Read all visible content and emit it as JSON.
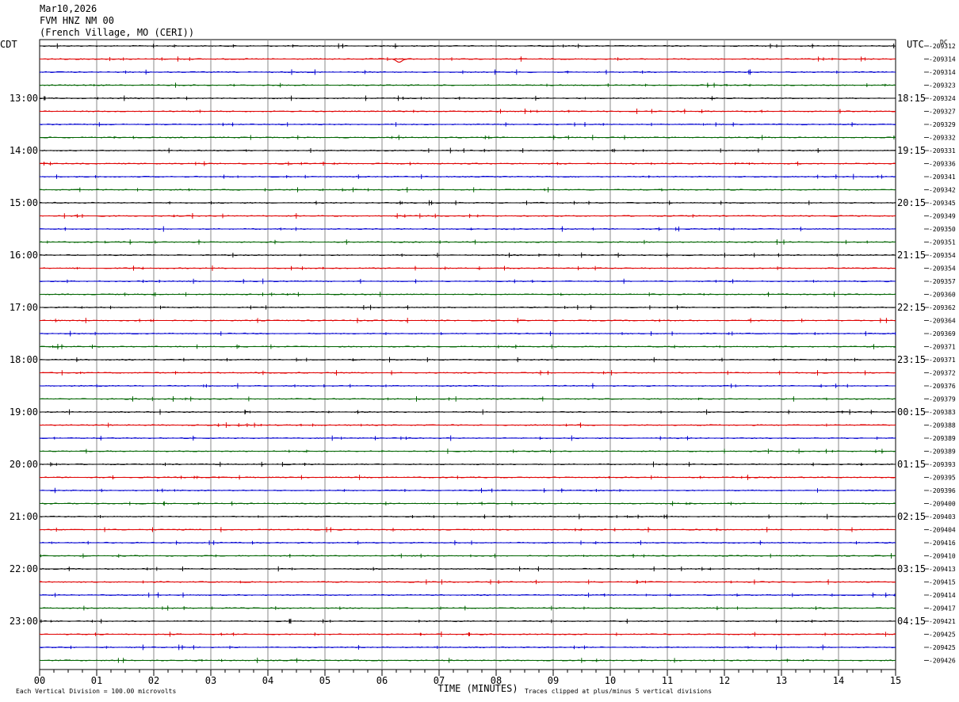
{
  "header": {
    "date": "Mar10,2026",
    "station": "FVM HNZ NM 00",
    "location": "(French Village, MO (CERI))"
  },
  "chart_data": {
    "type": "line",
    "left_timezone": "CDT",
    "right_timezone": "UTC",
    "dc_label": "DC",
    "x_axis_label": "TIME (MINUTES)",
    "x_ticks": [
      "00",
      "01",
      "02",
      "03",
      "04",
      "05",
      "06",
      "07",
      "08",
      "09",
      "10",
      "11",
      "12",
      "13",
      "14",
      "15"
    ],
    "xlim": [
      0,
      15
    ],
    "left_hour_labels": [
      "13:00",
      "14:00",
      "15:00",
      "16:00",
      "17:00",
      "18:00",
      "19:00",
      "20:00",
      "21:00",
      "22:00",
      "23:00"
    ],
    "right_hour_labels": [
      "18:15",
      "19:15",
      "20:15",
      "21:15",
      "22:15",
      "23:15",
      "00:15",
      "01:15",
      "02:15",
      "03:15",
      "04:15"
    ],
    "trace_colors": [
      "#000000",
      "#e00000",
      "#0000d0",
      "#006400"
    ],
    "dc_values": [
      "-209312",
      "-209314",
      "-209314",
      "-209323",
      "-209324",
      "-209327",
      "-209329",
      "-209332",
      "-209331",
      "-209336",
      "-209341",
      "-209342",
      "-209345",
      "-209349",
      "-209350",
      "-209351",
      "-209354",
      "-209354",
      "-209357",
      "-209360",
      "-209362",
      "-209364",
      "-209369",
      "-209371",
      "-209371",
      "-209372",
      "-209376",
      "-209379",
      "-209383",
      "-209388",
      "-209389",
      "-209389",
      "-209393",
      "-209395",
      "-209396",
      "-209400",
      "-209403",
      "-209404",
      "-209416",
      "-209410",
      "-209413",
      "-209415",
      "-209414",
      "-209417",
      "-209421",
      "-209425",
      "-209425",
      "-209426"
    ],
    "footer_left": "Each Vertical Division =  100.00 microvolts",
    "footer_right": "Traces clipped at plus/minus 5 vertical divisions",
    "events": [
      {
        "trace": 1,
        "minute": 6.3,
        "amplitude": 4
      }
    ]
  }
}
